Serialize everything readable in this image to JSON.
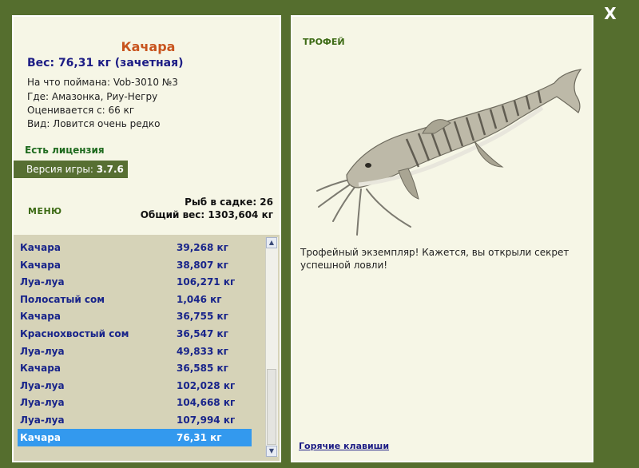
{
  "close_label": "X",
  "fish": {
    "name": "Качара",
    "weight_line": "Вес: 76,31 кг (зачетная)",
    "bait_line": "На что поймана: Vob-3010 №3",
    "place_line": "Где: Амазонка, Риу-Негру",
    "price_line": "Оценивается с: 66 кг",
    "kind_line": "Вид: Ловится очень редко"
  },
  "license": "Есть лицензия",
  "version": {
    "label": "Версия игры:",
    "value": "3.7.6"
  },
  "menu_label": "МЕНЮ",
  "summary": {
    "fish_count": "Рыб в садке: 26",
    "total_weight": "Общий вес: 1303,604 кг"
  },
  "catch_list": [
    {
      "name": "Качара",
      "weight": "39,268 кг"
    },
    {
      "name": "Качара",
      "weight": "38,807 кг"
    },
    {
      "name": "Луа-луа",
      "weight": "106,271 кг"
    },
    {
      "name": "Полосатый сом",
      "weight": "1,046 кг"
    },
    {
      "name": "Качара",
      "weight": "36,755 кг"
    },
    {
      "name": "Краснохвостый сом",
      "weight": "36,547 кг"
    },
    {
      "name": "Луа-луа",
      "weight": "49,833 кг"
    },
    {
      "name": "Качара",
      "weight": "36,585 кг"
    },
    {
      "name": "Луа-луа",
      "weight": "102,028 кг"
    },
    {
      "name": "Луа-луа",
      "weight": "104,668 кг"
    },
    {
      "name": "Луа-луа",
      "weight": "107,994 кг"
    },
    {
      "name": "Качара",
      "weight": "76,31 кг",
      "selected": true
    }
  ],
  "trophy": {
    "title": "ТРОФЕЙ",
    "text": "Трофейный экземпляр! Кажется, вы открыли секрет успешной ловли!"
  },
  "hotkeys_label": "Горячие клавиши",
  "colors": {
    "background": "#556e2e",
    "panel": "#f6f6e6",
    "list_bg": "#d6d3b8",
    "selected_row": "#3399ee",
    "fish_name": "#c8541e",
    "link_blue": "#1d1d85"
  }
}
